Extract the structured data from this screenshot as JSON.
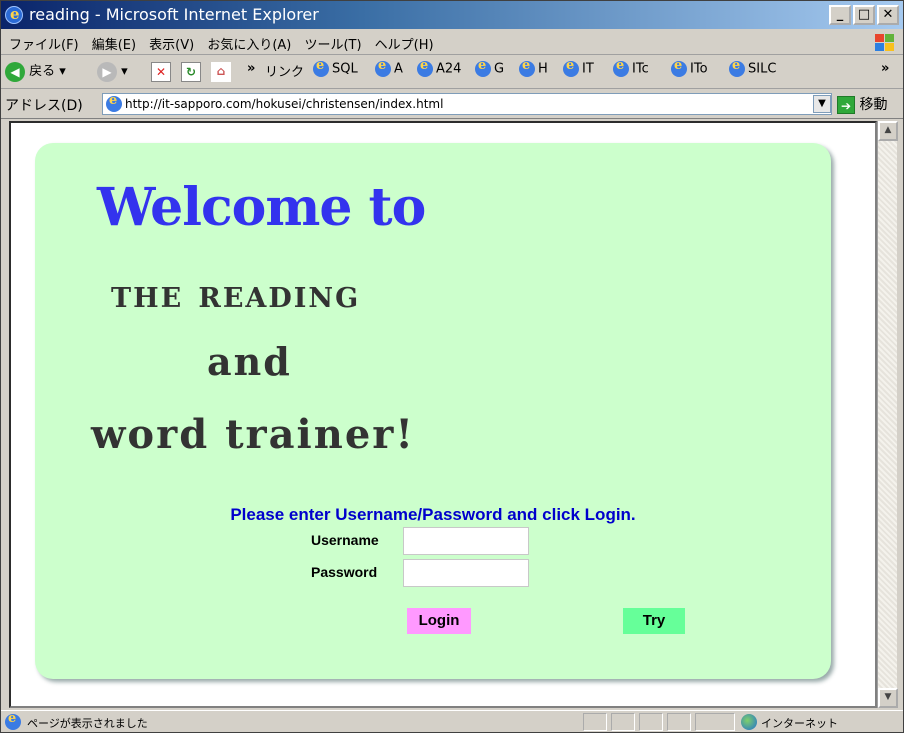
{
  "window": {
    "title": "reading - Microsoft Internet Explorer"
  },
  "menu": [
    "ファイル(F)",
    "編集(E)",
    "表示(V)",
    "お気に入り(A)",
    "ツール(T)",
    "ヘルプ(H)"
  ],
  "toolbar": {
    "back_label": "戻る",
    "more": "»",
    "links_label": "リンク",
    "links": [
      "SQL",
      "A",
      "A24",
      "G",
      "H",
      "IT",
      "ITc",
      "ITo",
      "SILC"
    ],
    "overflow": "»"
  },
  "address": {
    "label": "アドレス(D)",
    "url": "http://it-sapporo.com/hokusei/christensen/index.html",
    "go_label": "移動"
  },
  "page": {
    "welcome": "Welcome to",
    "line2": "the reading",
    "line3": "and",
    "line4": "word trainer!",
    "instructions": "Please enter Username/Password and click Login.",
    "username_label": "Username",
    "password_label": "Password",
    "username_value": "",
    "password_value": "",
    "login_label": "Login",
    "try_label": "Try"
  },
  "status": {
    "text": "ページが表示されました",
    "zone": "インターネット"
  },
  "colors": {
    "panel_bg": "#ccffcc",
    "welcome": "#3333ee",
    "instructions": "#0000cc",
    "login_bg": "#ff99ff",
    "try_bg": "#66ff99"
  }
}
